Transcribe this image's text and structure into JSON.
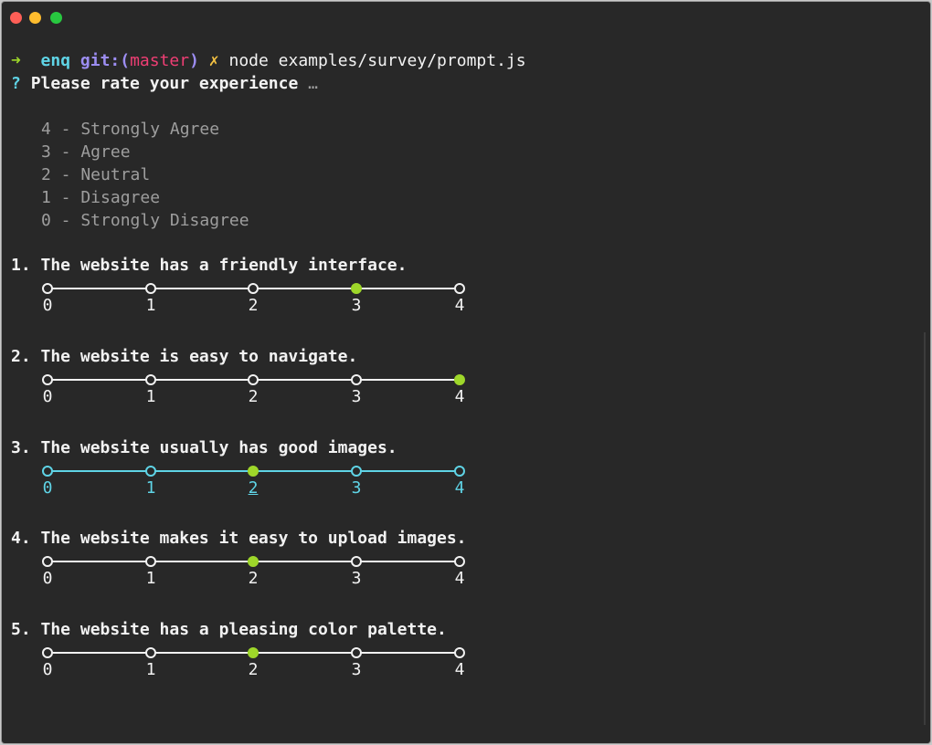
{
  "prompt_line": {
    "arrow": "➜",
    "dir": "enq",
    "git_prefix": "git:(",
    "branch": "master",
    "git_suffix": ")",
    "dirty": "✗",
    "command": "node examples/survey/prompt.js"
  },
  "question": {
    "mark": "?",
    "text": "Please rate your experience",
    "ellipsis": "…"
  },
  "legend": [
    "4 - Strongly Agree",
    "3 - Agree",
    "2 - Neutral",
    "1 - Disagree",
    "0 - Strongly Disagree"
  ],
  "scale_labels": [
    "0",
    "1",
    "2",
    "3",
    "4"
  ],
  "colors": {
    "selected": "#9ed72a",
    "active": "#5fd4e6",
    "text": "#f2f2f2"
  },
  "items": [
    {
      "label": "1. The website has a friendly interface.",
      "selected": 3,
      "active": false
    },
    {
      "label": "2. The website is easy to navigate.",
      "selected": 4,
      "active": false
    },
    {
      "label": "3. The website usually has good images.",
      "selected": 2,
      "active": true
    },
    {
      "label": "4. The website makes it easy to upload images.",
      "selected": 2,
      "active": false
    },
    {
      "label": "5. The website has a pleasing color palette.",
      "selected": 2,
      "active": false
    }
  ]
}
